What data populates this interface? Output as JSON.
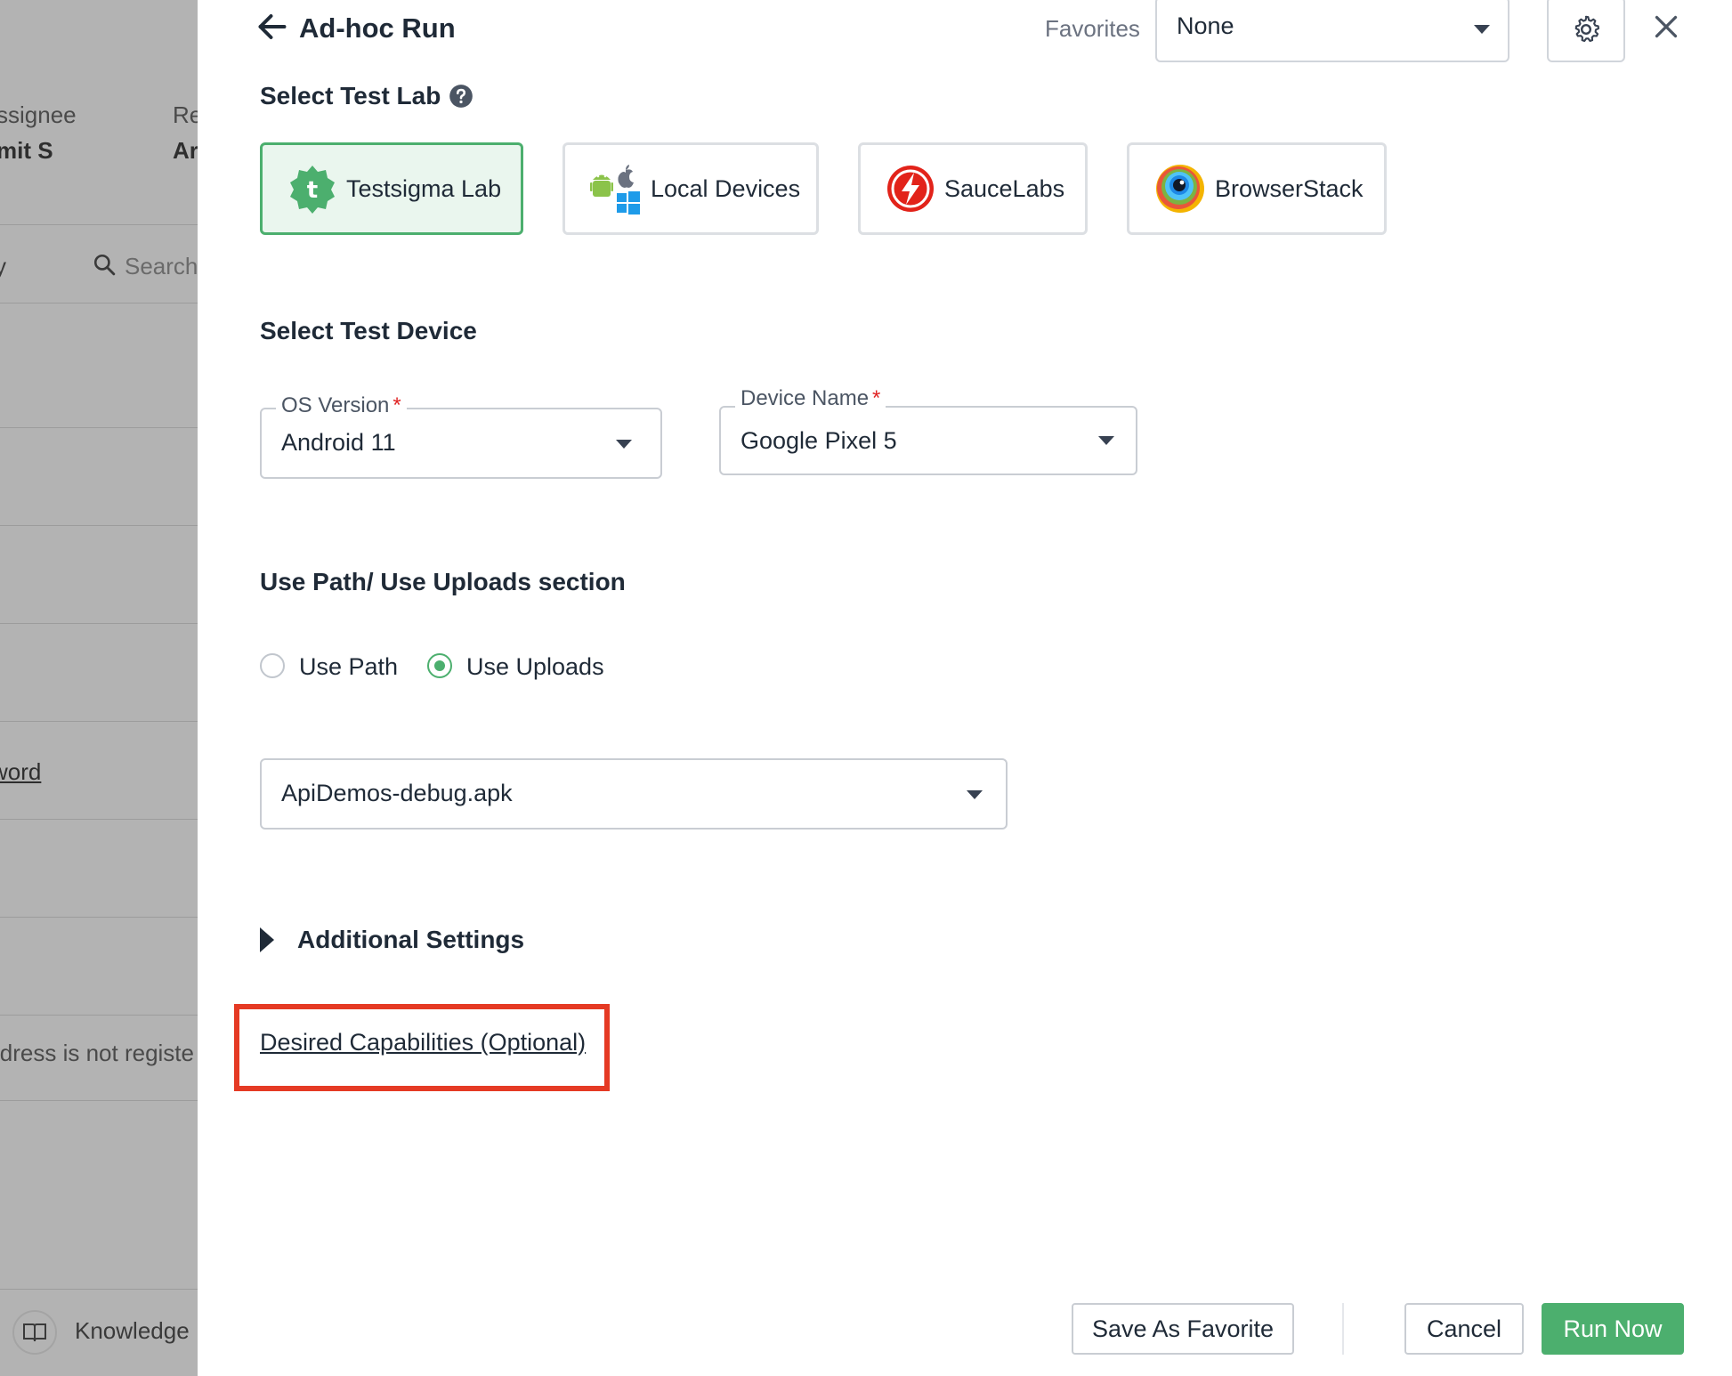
{
  "background": {
    "col_assignee_header": "ssignee",
    "col_assignee_value": "mit S",
    "col_re_header": "Re",
    "col_re_value": "Ar",
    "left_y": "y",
    "search_placeholder": "Search",
    "link_fragment": "word",
    "error_fragment": "ldress is not registe",
    "knowledge_label": "Knowledge"
  },
  "header": {
    "title": "Ad-hoc Run",
    "favorites_label": "Favorites",
    "favorites_value": "None"
  },
  "test_lab": {
    "section_title": "Select Test Lab",
    "labs": [
      {
        "label": "Testsigma Lab",
        "active": true
      },
      {
        "label": "Local Devices",
        "active": false
      },
      {
        "label": "SauceLabs",
        "active": false
      },
      {
        "label": "BrowserStack",
        "active": false
      }
    ]
  },
  "test_device": {
    "section_title": "Select Test Device",
    "os_version_label": "OS Version",
    "os_version_value": "Android 11",
    "device_name_label": "Device Name",
    "device_name_value": "Google Pixel 5",
    "required_mark": "*"
  },
  "uploads": {
    "section_title": "Use Path/ Use Uploads section",
    "options": [
      {
        "label": "Use Path",
        "checked": false
      },
      {
        "label": "Use Uploads",
        "checked": true
      }
    ],
    "selected_file": "ApiDemos-debug.apk"
  },
  "additional_settings": {
    "label": "Additional Settings"
  },
  "desired_capabilities": {
    "link_text": "Desired Capabilities (Optional)"
  },
  "footer": {
    "save_favorite": "Save As Favorite",
    "cancel": "Cancel",
    "run_now": "Run Now"
  },
  "colors": {
    "accent_green": "#4caf6e",
    "highlight_red": "#e53a24",
    "required_red": "#e02424",
    "overlay_gray": "#b3b3b3"
  }
}
